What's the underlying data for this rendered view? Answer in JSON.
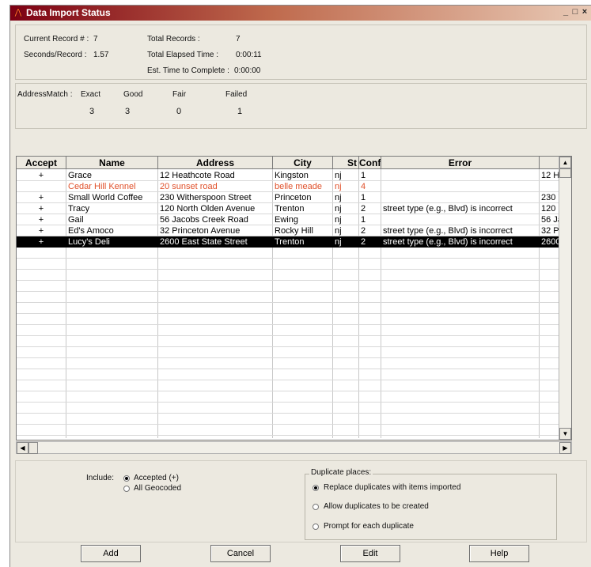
{
  "window": {
    "title": "Data Import Status",
    "controls": [
      "_",
      "□",
      "×"
    ]
  },
  "stats": {
    "current_record_label": "Current Record # :",
    "current_record_value": "7",
    "seconds_per_record_label": "Seconds/Record :",
    "seconds_per_record_value": "1.57",
    "total_records_label": "Total Records :",
    "total_records_value": "7",
    "elapsed_label": "Total Elapsed Time :",
    "elapsed_value": "0:00:11",
    "est_label": "Est. Time to Complete :",
    "est_value": "0:00:00"
  },
  "address_match": {
    "label": "AddressMatch :",
    "headers": [
      "Exact",
      "Good",
      "Fair",
      "Failed"
    ],
    "values": [
      "3",
      "3",
      "0",
      "1"
    ]
  },
  "grid": {
    "columns": [
      "Accept",
      "Name",
      "Address",
      "City",
      "St",
      "Conf",
      "Error",
      ""
    ],
    "rows": [
      {
        "accept": "+",
        "name": "Grace",
        "address": "12 Heathcote Road",
        "city": "Kingston",
        "st": "nj",
        "conf": "1",
        "error": "",
        "extra": "12 H"
      },
      {
        "accept": "",
        "name": "Cedar Hill Kennel",
        "address": "20 sunset road",
        "city": "belle meade",
        "st": "nj",
        "conf": "4",
        "error": "",
        "extra": ""
      },
      {
        "accept": "+",
        "name": "Small World Coffee",
        "address": "230 Witherspoon Street",
        "city": "Princeton",
        "st": "nj",
        "conf": "1",
        "error": "",
        "extra": "230 '"
      },
      {
        "accept": "+",
        "name": "Tracy",
        "address": "120 North Olden Avenue",
        "city": "Trenton",
        "st": "nj",
        "conf": "2",
        "error": "street type (e.g., Blvd) is incorrect",
        "extra": "120 I"
      },
      {
        "accept": "+",
        "name": "Gail",
        "address": "56 Jacobs Creek Road",
        "city": "Ewing",
        "st": "nj",
        "conf": "1",
        "error": "",
        "extra": "56 Ja"
      },
      {
        "accept": "+",
        "name": "Ed's Amoco",
        "address": "32 Princeton Avenue",
        "city": "Rocky Hill",
        "st": "nj",
        "conf": "2",
        "error": "street type (e.g., Blvd) is incorrect",
        "extra": "32 P"
      },
      {
        "accept": "+",
        "name": "Lucy's Deli",
        "address": "2600 East State Street",
        "city": "Trenton",
        "st": "nj",
        "conf": "2",
        "error": "street type (e.g., Blvd) is incorrect",
        "extra": "2600"
      }
    ],
    "failed_row_color": "#e0502a",
    "selected_row_index": 6
  },
  "include": {
    "label": "Include:",
    "options": [
      "Accepted (+)",
      "All Geocoded"
    ],
    "selected": "Accepted (+)"
  },
  "duplicates": {
    "label": "Duplicate places:",
    "options": [
      "Replace duplicates with items imported",
      "Allow duplicates to be created",
      "Prompt for each duplicate"
    ],
    "selected": "Replace duplicates with items imported"
  },
  "buttons": {
    "add": "Add",
    "cancel": "Cancel",
    "edit": "Edit",
    "help": "Help"
  },
  "icons": {
    "app": "app-logo-icon",
    "scroll_up": "arrow-up-icon",
    "scroll_down": "arrow-down-icon",
    "scroll_left": "arrow-left-icon",
    "scroll_right": "arrow-right-icon"
  }
}
